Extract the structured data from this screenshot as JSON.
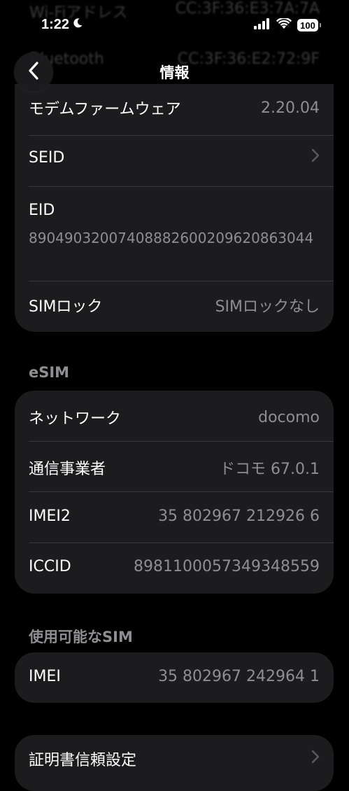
{
  "ghost": {
    "wifi_label": "Wi-Fiアドレス",
    "wifi_value": "CC:3F:36:E3:7A:7A",
    "bt_label": "Bluetooth",
    "bt_value": "CC:3F:36:E2:72:9F"
  },
  "status_bar": {
    "time": "1:22",
    "battery": "100",
    "icons": [
      "moon-icon",
      "cellular-signal-icon",
      "wifi-icon",
      "battery-icon"
    ]
  },
  "nav": {
    "title": "情報",
    "back_icon": "chevron-left-icon"
  },
  "top_card": {
    "rows": [
      {
        "label": "モデムファームウェア",
        "value": "2.20.04"
      },
      {
        "label": "SEID",
        "value": ""
      },
      {
        "label": "SIMロック",
        "value": "SIMロックなし"
      }
    ],
    "eid": {
      "label": "EID",
      "value": "89049032007408882600209620863044"
    }
  },
  "esim": {
    "header": "eSIM",
    "rows": [
      {
        "label": "ネットワーク",
        "value": "docomo"
      },
      {
        "label": "通信事業者",
        "value": "ドコモ 67.0.1"
      },
      {
        "label": "IMEI2",
        "value": "35 802967 212926 6"
      },
      {
        "label": "ICCID",
        "value": "8981100057349348559"
      }
    ]
  },
  "available_sim": {
    "header": "使用可能なSIM",
    "rows": [
      {
        "label": "IMEI",
        "value": "35 802967 242964 1"
      }
    ]
  },
  "cert": {
    "label": "証明書信頼設定"
  },
  "colors": {
    "background": "#000000",
    "card": "#1c1c1e",
    "secondary_text": "#8e8e93",
    "divider": "#38383a"
  }
}
